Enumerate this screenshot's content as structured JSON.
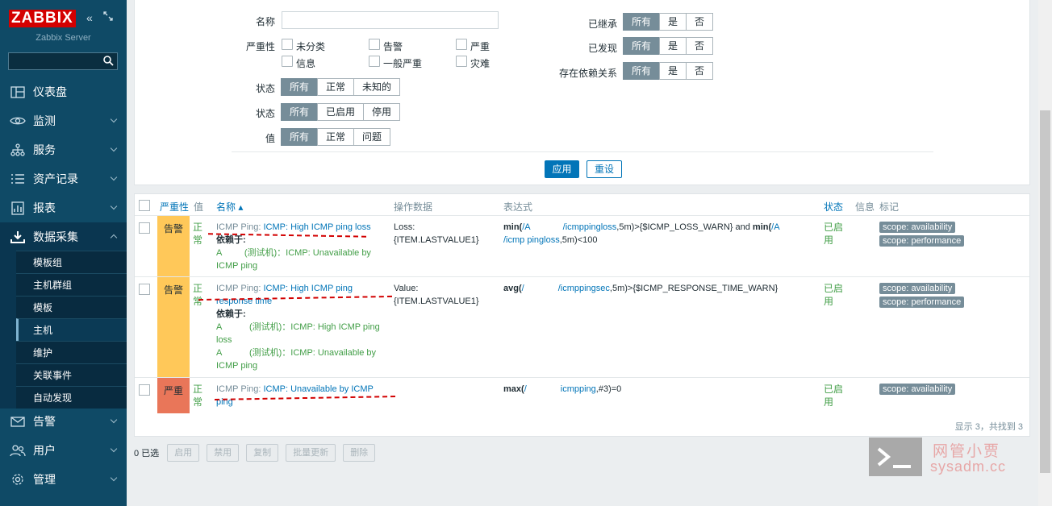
{
  "sidebar": {
    "logo": "ZABBIX",
    "server": "Zabbix Server",
    "search_placeholder": "",
    "items": [
      {
        "label": "仪表盘",
        "icon": "dashboard-icon"
      },
      {
        "label": "监测",
        "icon": "eye-icon"
      },
      {
        "label": "服务",
        "icon": "services-icon"
      },
      {
        "label": "资产记录",
        "icon": "list-icon"
      },
      {
        "label": "报表",
        "icon": "report-icon"
      },
      {
        "label": "数据采集",
        "icon": "download-icon"
      },
      {
        "label": "告警",
        "icon": "mail-icon"
      },
      {
        "label": "用户",
        "icon": "users-icon"
      },
      {
        "label": "管理",
        "icon": "gear-icon"
      }
    ],
    "submenu": [
      "模板组",
      "主机群组",
      "模板",
      "主机",
      "维护",
      "关联事件",
      "自动发现"
    ]
  },
  "filter": {
    "name_label": "名称",
    "name_value": "",
    "severity_label": "严重性",
    "severities": [
      "未分类",
      "告警",
      "严重",
      "信息",
      "一般严重",
      "灾难"
    ],
    "state_label": "状态",
    "state_options": [
      "所有",
      "正常",
      "未知的"
    ],
    "status_label": "状态",
    "status_options": [
      "所有",
      "已启用",
      "停用"
    ],
    "value_label": "值",
    "value_options": [
      "所有",
      "正常",
      "问题"
    ],
    "inherited_label": "已继承",
    "discovered_label": "已发现",
    "depends_label": "存在依赖关系",
    "yesno": [
      "所有",
      "是",
      "否"
    ],
    "apply": "应用",
    "reset": "重设"
  },
  "table": {
    "headers": {
      "severity": "严重性",
      "value": "值",
      "name": "名称 ▴",
      "opdata": "操作数据",
      "expression": "表达式",
      "status": "状态",
      "info": "信息",
      "tags": "标记"
    },
    "rows": [
      {
        "severity": "告警",
        "value": "正常",
        "prefix": "ICMP Ping:",
        "name": "ICMP: High ICMP ping loss",
        "depends_label": "依赖于:",
        "deps": [
          "A         (测试机)：ICMP: Unavailable by ICMP ping"
        ],
        "opdata": "Loss: {ITEM.LASTVALUE1}",
        "expr": {
          "fn1": "min(",
          "a1": "/A",
          "k1": "/icmppingloss",
          "rest1": ",5m)>{$ICMP_LOSS_WARN} and ",
          "fn2": "min(",
          "a2": "/A",
          "k2": "/icmp pingloss",
          "rest2": ",5m)<100"
        },
        "status": "已启用",
        "tags": [
          "scope: availability",
          "scope: performance"
        ]
      },
      {
        "severity": "告警",
        "value": "正常",
        "prefix": "ICMP Ping:",
        "name": "ICMP: High ICMP ping response time",
        "depends_label": "依赖于:",
        "deps": [
          "A           (测试机)：ICMP: High ICMP ping loss",
          "A           (测试机)：ICMP: Unavailable by ICMP ping"
        ],
        "opdata": "Value: {ITEM.LASTVALUE1}",
        "expr": {
          "fn1": "avg(",
          "a1": "/",
          "k1": "/icmppingsec",
          "rest1": ",5m)>{$ICMP_RESPONSE_TIME_WARN}"
        },
        "status": "已启用",
        "tags": [
          "scope: availability",
          "scope: performance"
        ]
      },
      {
        "severity": "严重",
        "value": "正常",
        "prefix": "ICMP Ping:",
        "name": "ICMP: Unavailable by ICMP ping",
        "opdata": "",
        "expr": {
          "fn1": "max(",
          "a1": "/",
          "k1": "icmpping",
          "rest1": ",#3)=0"
        },
        "status": "已启用",
        "tags": [
          "scope: availability"
        ]
      }
    ],
    "footer": "显示 3，共找到 3"
  },
  "actions": {
    "selected": "0 已选",
    "buttons": [
      "启用",
      "禁用",
      "复制",
      "批量更新",
      "删除"
    ]
  },
  "watermark": {
    "cn": "网管小贾",
    "en": "sysadm.cc"
  },
  "colors": {
    "sidebar": "#0f4a66",
    "warning": "#ffc859",
    "high": "#e97659",
    "link": "#0275b8",
    "ok": "#429e47"
  }
}
